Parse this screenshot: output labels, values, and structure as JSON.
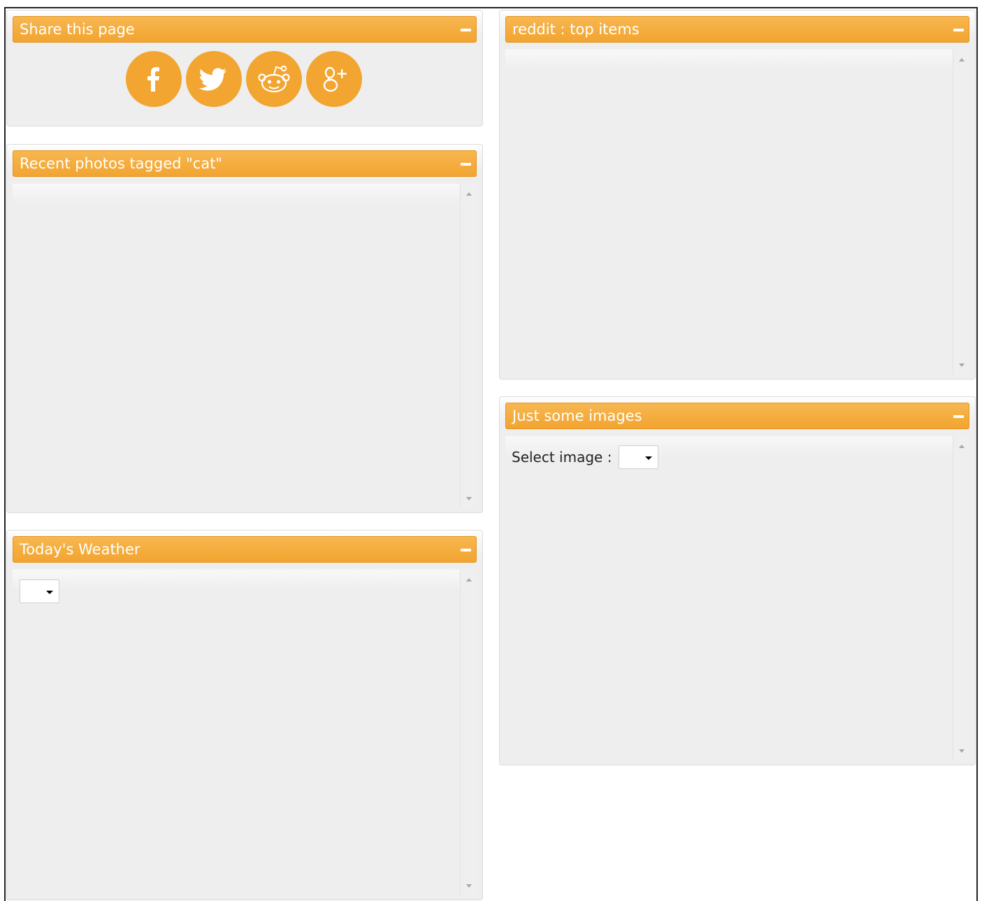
{
  "widgets": {
    "share": {
      "title": "Share this page"
    },
    "photos": {
      "title": "Recent photos tagged \"cat\""
    },
    "weather": {
      "title": "Today's Weather",
      "select_value": ""
    },
    "reddit": {
      "title": "reddit : top items"
    },
    "images": {
      "title": "Just some images",
      "select_label": "Select image :",
      "select_value": ""
    }
  },
  "share_buttons": [
    {
      "name": "facebook",
      "icon": "facebook-icon"
    },
    {
      "name": "twitter",
      "icon": "twitter-icon"
    },
    {
      "name": "reddit",
      "icon": "reddit-icon"
    },
    {
      "name": "google-plus",
      "icon": "google-plus-icon"
    }
  ],
  "colors": {
    "header_accent": "#f2a430",
    "share_button": "#f2a530",
    "panel_bg": "#eeeeee"
  }
}
